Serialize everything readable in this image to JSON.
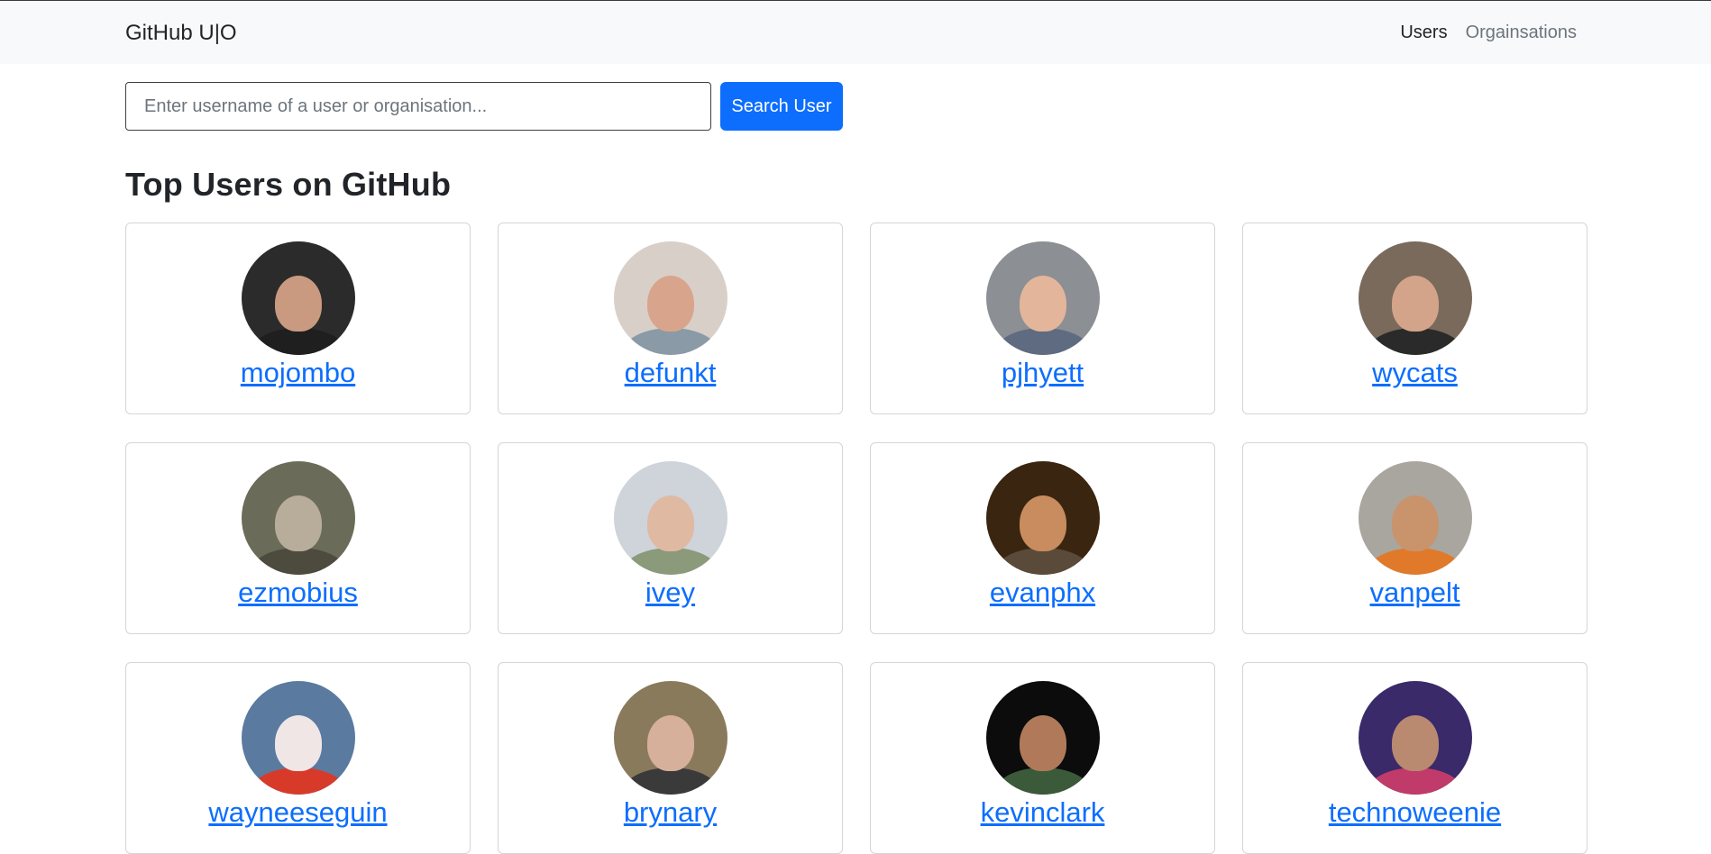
{
  "navbar": {
    "brand": "GitHub U|O",
    "links": [
      {
        "label": "Users",
        "active": true
      },
      {
        "label": "Orgainsations",
        "active": false
      }
    ]
  },
  "search": {
    "placeholder": "Enter username of a user or organisation...",
    "value": "",
    "button_label": "Search User"
  },
  "section": {
    "title": "Top Users on GitHub"
  },
  "users": [
    {
      "username": "mojombo",
      "bg": "#2b2b2b",
      "skin": "#c99a80",
      "shirt": "#1f1f1f"
    },
    {
      "username": "defunkt",
      "bg": "#d9cfc9",
      "skin": "#d8a58c",
      "shirt": "#8a9aa6"
    },
    {
      "username": "pjhyett",
      "bg": "#8c8f94",
      "skin": "#e3b59a",
      "shirt": "#5e6b80"
    },
    {
      "username": "wycats",
      "bg": "#7a6a5c",
      "skin": "#d4a48a",
      "shirt": "#2a2a2a"
    },
    {
      "username": "ezmobius",
      "bg": "#6b6b5a",
      "skin": "#b7ad9a",
      "shirt": "#4d4a3e"
    },
    {
      "username": "ivey",
      "bg": "#cfd3da",
      "skin": "#e0b9a3",
      "shirt": "#8a9a7a"
    },
    {
      "username": "evanphx",
      "bg": "#3a2510",
      "skin": "#c88c5e",
      "shirt": "#5a4a3a"
    },
    {
      "username": "vanpelt",
      "bg": "#a9a6a0",
      "skin": "#c9936c",
      "shirt": "#e07a2a"
    },
    {
      "username": "wayneeseguin",
      "bg": "#5a7aa0",
      "skin": "#f0e6e6",
      "shirt": "#d83a2a"
    },
    {
      "username": "brynary",
      "bg": "#8a7a5c",
      "skin": "#d6b09a",
      "shirt": "#3a3a3a"
    },
    {
      "username": "kevinclark",
      "bg": "#0c0c0c",
      "skin": "#b07a5a",
      "shirt": "#3a5a3a"
    },
    {
      "username": "technoweenie",
      "bg": "#3a2a6a",
      "skin": "#b98a70",
      "shirt": "#c03a6a"
    }
  ],
  "colors": {
    "accent": "#0d6efd",
    "navbar_bg": "#f8f9fa",
    "muted": "#6c757d"
  }
}
